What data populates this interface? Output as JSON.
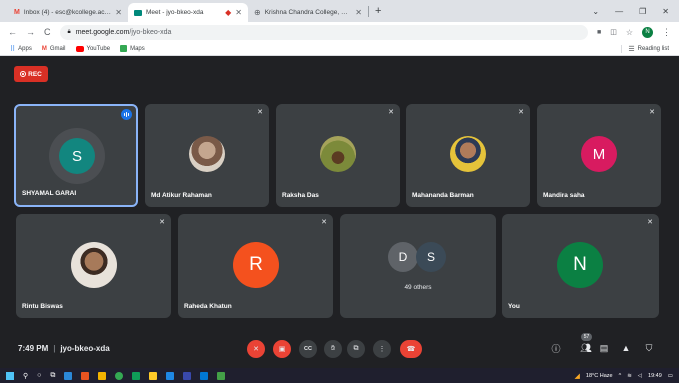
{
  "browser": {
    "tabs": [
      {
        "title": "Inbox (4) - esc@kcollege.ac.in -",
        "icon": "gmail-icon",
        "active": false
      },
      {
        "title": "Meet - jyo-bkeo-xda",
        "icon": "meet-icon",
        "active": true
      },
      {
        "title": "Krishna Chandra College, Hetam",
        "icon": "globe-icon",
        "active": false
      }
    ],
    "new_tab": "+",
    "address": {
      "host": "meet.google.com",
      "path": "/jyo-bkeo-xda"
    },
    "profile_initial": "N",
    "bookmarks": [
      {
        "label": "Apps",
        "color": "#5f6368"
      },
      {
        "label": "Gmail",
        "color": "#ea4335"
      },
      {
        "label": "YouTube",
        "color": "#ff0000"
      },
      {
        "label": "Maps",
        "color": "#34a853"
      }
    ],
    "reading_list": "Reading list"
  },
  "meet": {
    "rec_label": "REC",
    "participants": [
      {
        "name": "SHYAMAL GARAI",
        "initial": "S",
        "avatar_color": "#12867f",
        "speaking": true
      },
      {
        "name": "Md Atikur Rahaman",
        "initial": "",
        "avatar_color": "#8a6d5a",
        "photo": true
      },
      {
        "name": "Raksha Das",
        "initial": "",
        "avatar_color": "#6b7a3c",
        "photo": true
      },
      {
        "name": "Mahananda Barman",
        "initial": "",
        "avatar_color": "#c7a02b",
        "photo": true
      },
      {
        "name": "Mandira saha",
        "initial": "M",
        "avatar_color": "#d81b60"
      },
      {
        "name": "Rintu Biswas",
        "initial": "",
        "avatar_color": "#7a5c49",
        "photo": true
      },
      {
        "name": "Raheda Khatun",
        "initial": "R",
        "avatar_color": "#f4511e"
      },
      {
        "name": "You",
        "initial": "N",
        "avatar_color": "#0b8043"
      }
    ],
    "others": {
      "initials": [
        "D",
        "S"
      ],
      "label": "49 others",
      "colors": [
        "#5f6368",
        "#3b4a57"
      ]
    },
    "time": "7:49 PM",
    "meeting_code": "jyo-bkeo-xda",
    "people_count": "57"
  },
  "taskbar": {
    "weather": "18°C  Haze",
    "clock": "19:49"
  },
  "colors": {
    "meet_bg": "#202124",
    "tile_bg": "#3c4043",
    "speaking_border": "#8ab4f8",
    "rec_red": "#d93025",
    "end_call_red": "#ea4335"
  }
}
